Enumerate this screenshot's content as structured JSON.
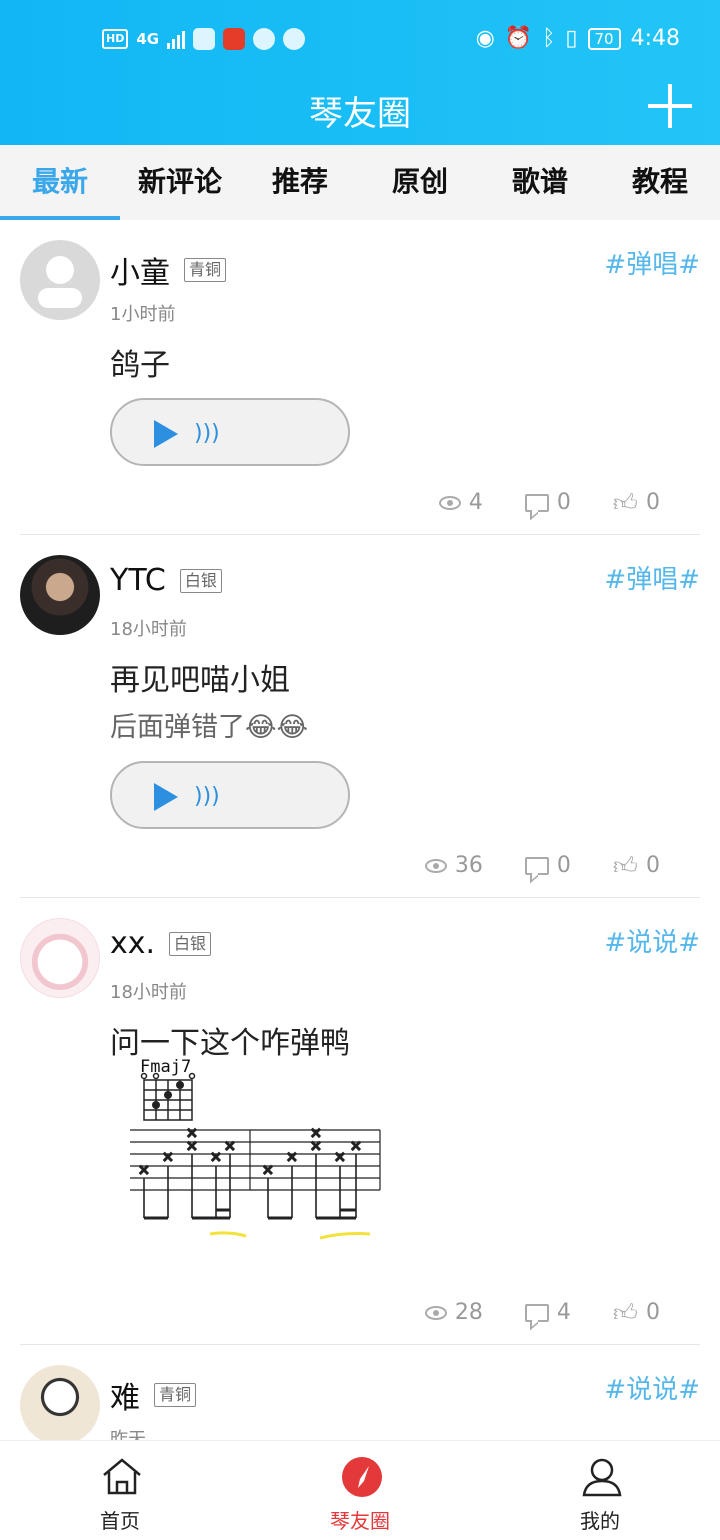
{
  "status_bar": {
    "network": "HD",
    "signal": "4G",
    "battery": "70",
    "time": "4:48"
  },
  "header": {
    "title": "琴友圈",
    "add_icon": "plus-icon"
  },
  "tabs": [
    {
      "label": "最新",
      "active": true
    },
    {
      "label": "新评论",
      "active": false
    },
    {
      "label": "推荐",
      "active": false
    },
    {
      "label": "原创",
      "active": false
    },
    {
      "label": "歌谱",
      "active": false
    },
    {
      "label": "教程",
      "active": false
    }
  ],
  "posts": [
    {
      "username": "小童",
      "level": "青铜",
      "time": "1小时前",
      "tag": "#弹唱#",
      "title": "鸽子",
      "subtitle": "",
      "has_audio": true,
      "views": "4",
      "comments": "0",
      "likes": "0"
    },
    {
      "username": "YTC",
      "level": "白银",
      "time": "18小时前",
      "tag": "#弹唱#",
      "title": "再见吧喵小姐",
      "subtitle": "后面弹错了😂😂",
      "has_audio": true,
      "views": "36",
      "comments": "0",
      "likes": "0"
    },
    {
      "username": "xx.",
      "level": "白银",
      "time": "18小时前",
      "tag": "#说说#",
      "title": "问一下这个咋弹鸭",
      "subtitle": "",
      "has_audio": false,
      "image_chord": "Fmaj7",
      "views": "28",
      "comments": "4",
      "likes": "0"
    },
    {
      "username": "难",
      "level": "青铜",
      "time": "昨天",
      "tag": "#说说#",
      "title": "",
      "subtitle": "",
      "has_audio": false,
      "views": "",
      "comments": "",
      "likes": ""
    }
  ],
  "bottom_nav": [
    {
      "label": "首页",
      "icon": "home-icon",
      "active": false
    },
    {
      "label": "琴友圈",
      "icon": "compass-icon",
      "active": true
    },
    {
      "label": "我的",
      "icon": "user-icon",
      "active": false
    }
  ],
  "colors": {
    "header": "#17bcf5",
    "accent": "#3aa7ea",
    "tag": "#56b7ea",
    "active_nav": "#e3393a",
    "play": "#2c8fe0"
  }
}
